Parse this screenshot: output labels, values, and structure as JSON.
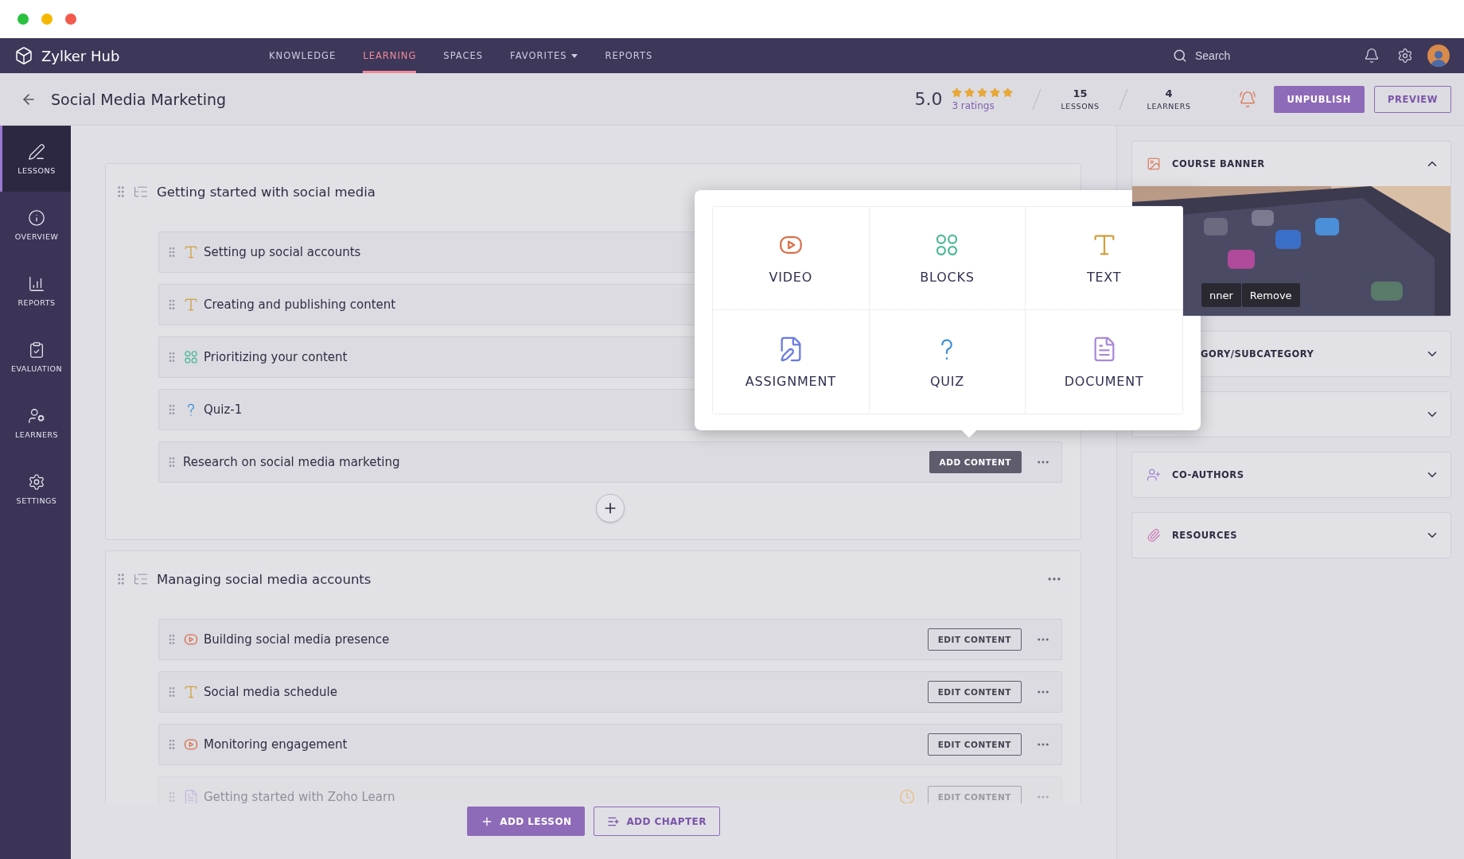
{
  "nav": {
    "brand": "Zylker Hub",
    "items": [
      {
        "label": "KNOWLEDGE",
        "selected": false,
        "dropdown": false
      },
      {
        "label": "LEARNING",
        "selected": true,
        "dropdown": false
      },
      {
        "label": "SPACES",
        "selected": false,
        "dropdown": false
      },
      {
        "label": "FAVORITES",
        "selected": false,
        "dropdown": true
      },
      {
        "label": "REPORTS",
        "selected": false,
        "dropdown": false
      }
    ],
    "search": {
      "placeholder": "Search"
    }
  },
  "header": {
    "title": "Social Media Marketing",
    "rating": "5.0",
    "stars": 5,
    "ratings_count": "3 ratings",
    "stats": [
      {
        "value": "15",
        "label": "LESSONS"
      },
      {
        "value": "4",
        "label": "LEARNERS"
      }
    ],
    "buttons": [
      {
        "label": "UNPUBLISH",
        "kind": "primary"
      },
      {
        "label": "PREVIEW",
        "kind": "outline"
      }
    ]
  },
  "sidebar": {
    "items": [
      {
        "label": "LESSONS",
        "selected": true
      },
      {
        "label": "OVERVIEW",
        "selected": false
      },
      {
        "label": "REPORTS",
        "selected": false
      },
      {
        "label": "EVALUATION",
        "selected": false
      },
      {
        "label": "LEARNERS",
        "selected": false
      },
      {
        "label": "SETTINGS",
        "selected": false
      }
    ]
  },
  "chapters": [
    {
      "title": "Getting started with social media",
      "menu": false,
      "add_button": true,
      "lessons": [
        {
          "title": "Setting up social accounts",
          "kind": "text",
          "faded": false,
          "scheduled": false
        },
        {
          "title": "Creating and publishing content",
          "kind": "text",
          "faded": false,
          "scheduled": false
        },
        {
          "title": "Prioritizing your content",
          "kind": "blocks",
          "faded": false,
          "scheduled": false
        },
        {
          "title": "Quiz-1",
          "kind": "quiz",
          "faded": false,
          "scheduled": false
        },
        {
          "title": "Research on social media marketing",
          "kind": "plain",
          "faded": false,
          "scheduled": false,
          "action": {
            "label": "ADD CONTENT",
            "kind": "add"
          },
          "menu": true
        }
      ]
    },
    {
      "title": "Managing social media accounts",
      "menu": true,
      "add_button": false,
      "lessons": [
        {
          "title": "Building social media presence",
          "kind": "video",
          "faded": false,
          "scheduled": false,
          "action": {
            "label": "EDIT CONTENT",
            "kind": "edit"
          },
          "menu": true
        },
        {
          "title": "Social media schedule",
          "kind": "text",
          "faded": false,
          "scheduled": false,
          "action": {
            "label": "EDIT CONTENT",
            "kind": "edit"
          },
          "menu": true
        },
        {
          "title": "Monitoring engagement",
          "kind": "video",
          "faded": false,
          "scheduled": false,
          "action": {
            "label": "EDIT CONTENT",
            "kind": "edit"
          },
          "menu": true
        },
        {
          "title": "Getting started with Zoho Learn",
          "kind": "document",
          "faded": true,
          "scheduled": true,
          "action": {
            "label": "EDIT CONTENT",
            "kind": "edit"
          },
          "menu": true
        }
      ]
    }
  ],
  "footer_buttons": [
    {
      "label": "ADD LESSON",
      "kind": "primary"
    },
    {
      "label": "ADD CHAPTER",
      "kind": "outline"
    }
  ],
  "content_popover": {
    "items": [
      {
        "label": "VIDEO",
        "kind": "video"
      },
      {
        "label": "BLOCKS",
        "kind": "blocks"
      },
      {
        "label": "TEXT",
        "kind": "text"
      },
      {
        "label": "ASSIGNMENT",
        "kind": "assignment"
      },
      {
        "label": "QUIZ",
        "kind": "quiz"
      },
      {
        "label": "DOCUMENT",
        "kind": "document"
      }
    ]
  },
  "panel": {
    "sections": [
      {
        "title": "COURSE BANNER",
        "kind": "banner",
        "expanded": true,
        "banner": {
          "kind": "picture",
          "buttons": [
            "nner",
            "Remove"
          ]
        }
      },
      {
        "title": "GORY/SUBCATEGORY",
        "kind": "hidden",
        "expanded": false
      },
      {
        "kind": "hidden",
        "expanded": false
      },
      {
        "title": "CO-AUTHORS",
        "kind": "coauthors",
        "expanded": false
      },
      {
        "title": "RESOURCES",
        "kind": "resources",
        "expanded": false
      }
    ]
  }
}
